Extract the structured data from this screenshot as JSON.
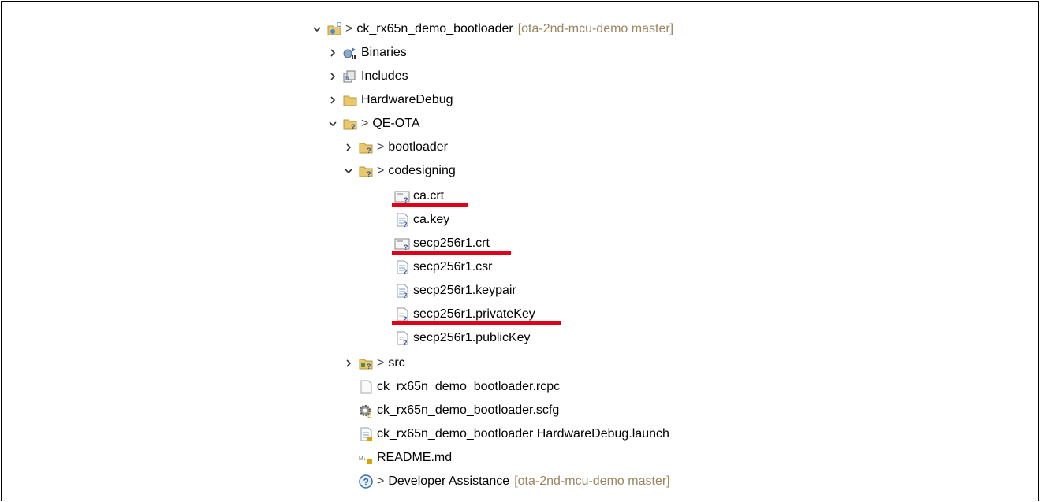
{
  "tree": {
    "root": {
      "label": "ck_rx65n_demo_bootloader",
      "decoration": "[ota-2nd-mcu-demo master]",
      "expanded": true
    },
    "items": [
      {
        "label": "Binaries",
        "expanded": false,
        "icon": "binaries-icon"
      },
      {
        "label": "Includes",
        "expanded": false,
        "icon": "includes-icon"
      },
      {
        "label": "HardwareDebug",
        "expanded": false,
        "icon": "folder-icon"
      },
      {
        "label": "QE-OTA",
        "expanded": true,
        "icon": "folder-unversioned-icon"
      },
      {
        "label": "bootloader",
        "expanded": false,
        "icon": "folder-unversioned-icon"
      },
      {
        "label": "codesigning",
        "expanded": true,
        "icon": "folder-unversioned-icon"
      },
      {
        "label": "ca.crt",
        "icon": "certificate-file-icon",
        "highlighted": true
      },
      {
        "label": "ca.key",
        "icon": "text-file-unversioned-icon"
      },
      {
        "label": "secp256r1.crt",
        "icon": "certificate-file-icon",
        "highlighted": true
      },
      {
        "label": "secp256r1.csr",
        "icon": "text-file-unversioned-icon"
      },
      {
        "label": "secp256r1.keypair",
        "icon": "text-file-unversioned-icon"
      },
      {
        "label": "secp256r1.privateKey",
        "icon": "generic-file-unversioned-icon",
        "highlighted": true
      },
      {
        "label": "secp256r1.publicKey",
        "icon": "generic-file-unversioned-icon"
      },
      {
        "label": "src",
        "expanded": false,
        "icon": "source-folder-icon"
      },
      {
        "label": "ck_rx65n_demo_bootloader.rcpc",
        "icon": "rcpc-file-icon"
      },
      {
        "label": "ck_rx65n_demo_bootloader.scfg",
        "icon": "scfg-gear-icon"
      },
      {
        "label": "ck_rx65n_demo_bootloader HardwareDebug.launch",
        "icon": "launch-file-icon"
      },
      {
        "label": "README.md",
        "icon": "markdown-file-icon"
      },
      {
        "label": "Developer Assistance",
        "decoration": "[ota-2nd-mcu-demo master]",
        "icon": "help-icon"
      }
    ]
  },
  "colors": {
    "highlight": "#e0001a",
    "decoration": "#9a8560",
    "folder": "#e8c86a"
  }
}
